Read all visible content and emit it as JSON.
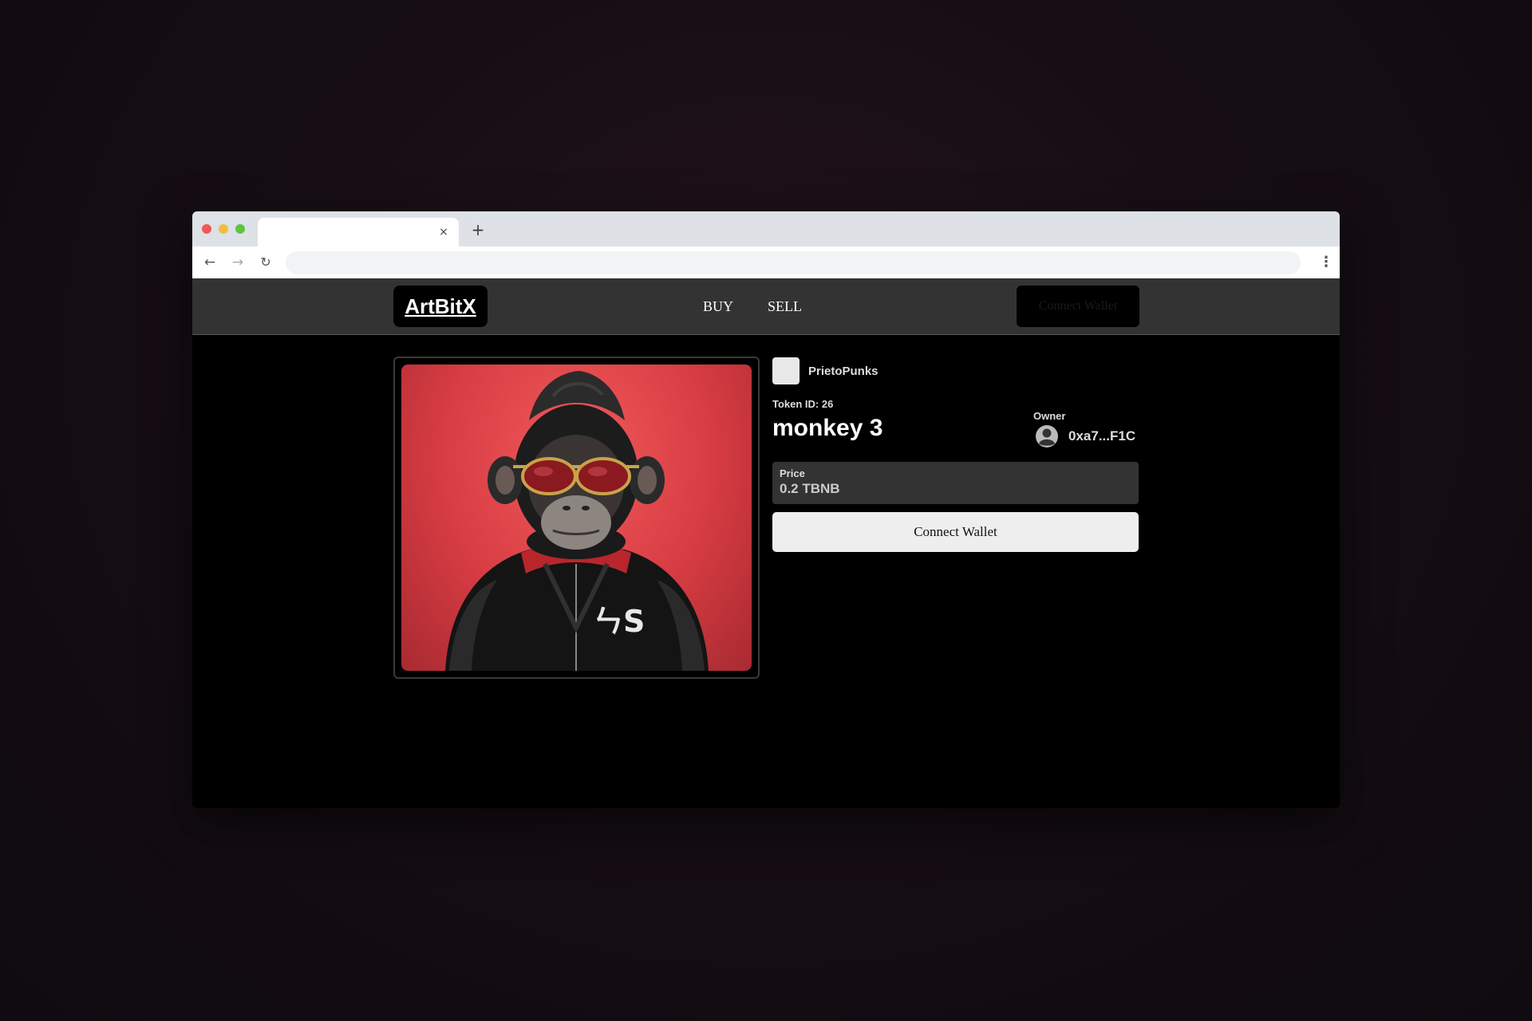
{
  "browser": {
    "tab_close_glyph": "×",
    "new_tab_glyph": "+",
    "back_glyph": "←",
    "forward_glyph": "→",
    "reload_glyph": "↻",
    "menu_glyph": "⋮",
    "address": ""
  },
  "header": {
    "logo": "ArtBitX",
    "nav": [
      {
        "label": "BUY"
      },
      {
        "label": "SELL"
      }
    ],
    "connect_wallet_label": "Connect Wallet"
  },
  "nft": {
    "collection": "PrietoPunks",
    "token_id": "Token ID: 26",
    "title": "monkey 3",
    "owner_label": "Owner",
    "owner_address": "0xa7...F1C",
    "price_label": "Price",
    "price_value": "0.2 TBNB",
    "connect_wallet_label": "Connect Wallet",
    "jacket_logo": "ㄣS"
  },
  "colors": {
    "page_background": "#000000",
    "header_background": "#333333",
    "image_background": "#d63c42",
    "button_background": "#eeeeee"
  },
  "icons": {
    "owner": "user-circle-icon",
    "collection": "collection-avatar",
    "close": "close-icon",
    "new_tab": "plus-icon",
    "back": "arrow-left-icon",
    "forward": "arrow-right-icon",
    "reload": "reload-icon",
    "menu": "kebab-menu-icon"
  }
}
